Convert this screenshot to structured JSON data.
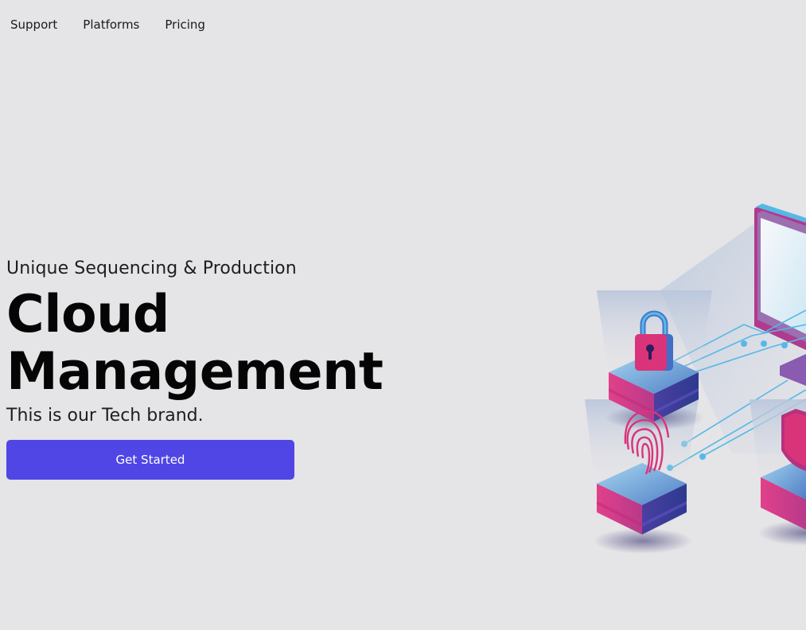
{
  "nav": {
    "items": [
      {
        "label": "Support"
      },
      {
        "label": "Platforms"
      },
      {
        "label": "Pricing"
      }
    ]
  },
  "hero": {
    "eyebrow": "Unique Sequencing & Production",
    "title_line1": "Cloud",
    "title_line2": "Management",
    "tagline": "This is our Tech brand.",
    "cta_label": "Get Started"
  },
  "colors": {
    "background": "#e5e4e7",
    "accent": "#5046e5",
    "illustration_pink": "#d9347a",
    "illustration_blue": "#3f5fbf",
    "illustration_cyan": "#55b8e6"
  },
  "illustration": {
    "icons": [
      "padlock-icon",
      "fingerprint-icon",
      "shield-icon",
      "monitor-icon"
    ]
  }
}
